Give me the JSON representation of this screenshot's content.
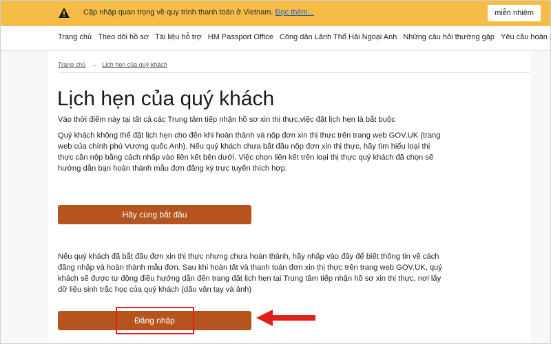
{
  "banner": {
    "message": "Cập nhập quan trọng về quy trình thanh toán ở Vietnam.",
    "link": "Đọc thêm...",
    "dismiss_label": "miễn nhiệm",
    "icon": "warning-icon",
    "color": "#f5bd47"
  },
  "nav": {
    "items": [
      "Trang chủ",
      "Theo dõi hồ sơ",
      "Tài liệu hỗ trợ",
      "HM Passport Office",
      "Công dân Lãnh Thổ Hải Ngoại Anh",
      "Những câu hỏi thường gặp",
      "Yêu cầu hoàn phí"
    ]
  },
  "breadcrumb": {
    "home": "Trang chủ",
    "separator": "→",
    "current": "Lịch hẹn của quý khách"
  },
  "page": {
    "title": "Lịch hẹn của quý khách",
    "intro": "Vào thời điểm này tại tất cả các Trung tâm tiếp nhận hồ sơ xin thị thực,việc đặt lịch hẹn là bắt buộc",
    "instructions": "Quý khách không thể đặt lịch hẹn cho đến khi hoàn thành và nộp đơn xin thị thực trên trang web GOV.UK (trang web của chính phủ Vương quốc Anh). Nếu quý khách chưa bắt đầu nộp đơn xin thị thực, hãy tìm hiểu loại thị thực cần nộp bằng cách nhấp vào liên kết bên dưới. Việc chọn liên kết trên loại thị thực quý khách đã chọn sẽ hướng dẫn bạn hoàn thành mẫu đơn đăng ký trực tuyến thích hợp.",
    "start_button": "Hãy cùng bắt đầu",
    "login_info": "Nếu quý khách đã bắt đầu đơn xin thị thực nhưng chưa hoàn thành, hãy nhấp vào đây để biết thông tin về cách đăng nhập và hoàn thành mẫu đơn. Sau khi hoàn tất và thanh toán đơn xin thị thực trên trang web GOV.UK, quý khách sẽ được tự động điều hướng dẫn đến trang đặt lịch hẹn tại Trung tâm tiếp nhận hồ sơ xin thị thực, nơi lấy dữ liệu sinh trắc học của quý khách (dấu vân tay và ảnh)",
    "login_button": "Đăng nhập",
    "button_color": "#b5541e"
  },
  "annotation": {
    "highlight_color": "#e0201b",
    "arrow_icon": "left-arrow-icon"
  }
}
